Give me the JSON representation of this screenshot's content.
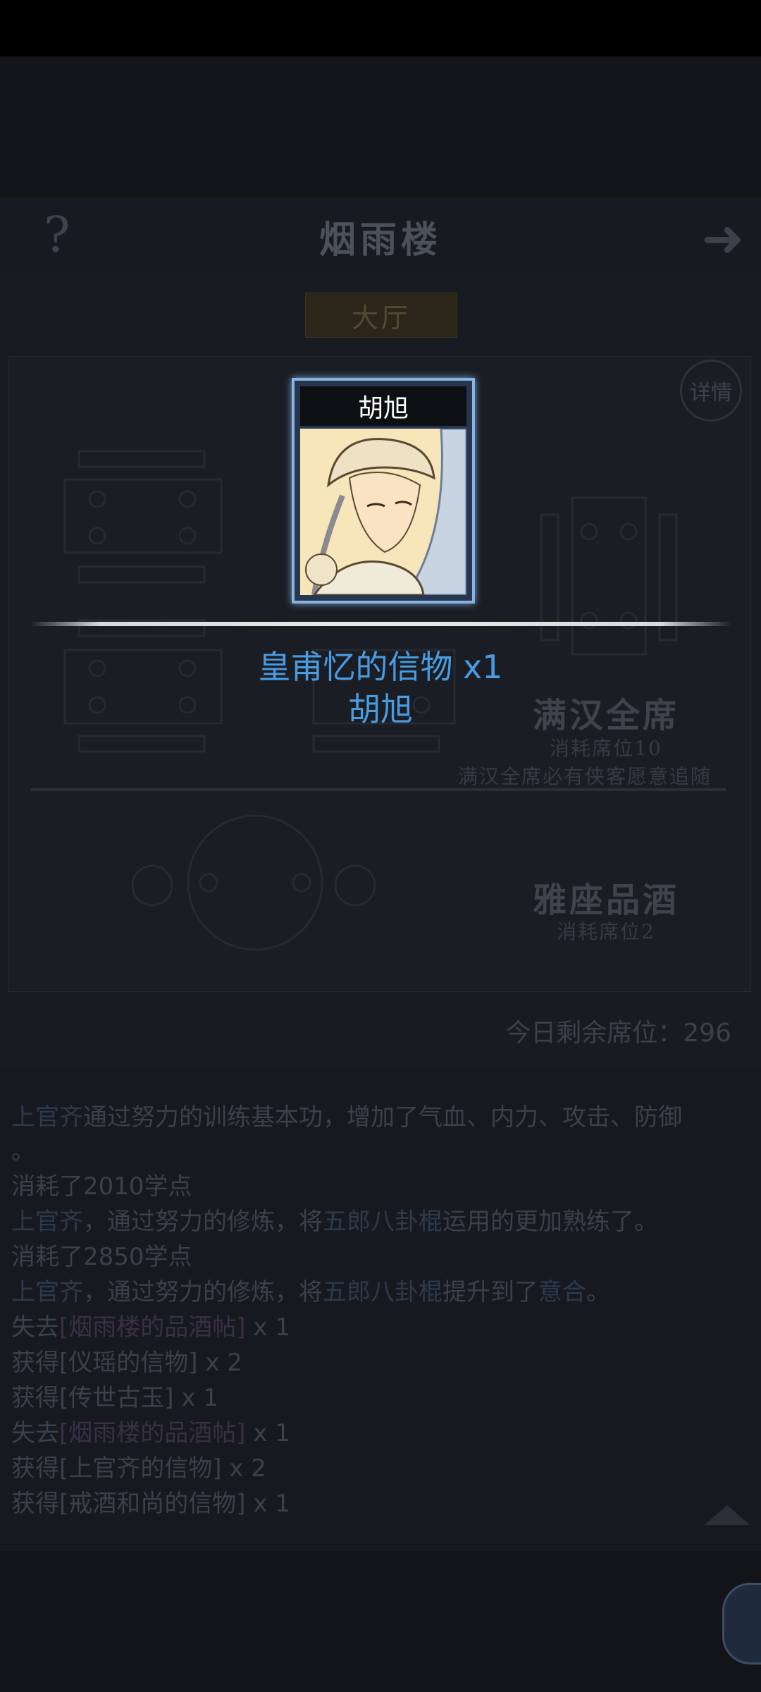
{
  "header": {
    "title": "烟雨楼",
    "help_icon": "question-mark-icon",
    "next_icon": "arrow-right-icon"
  },
  "tabs": {
    "hall": "大厅"
  },
  "details_button": "详情",
  "options": [
    {
      "title": "满汉全席",
      "cost": "消耗席位10",
      "note": "满汉全席必有侠客愿意追随"
    },
    {
      "title": "雅座品酒",
      "cost": "消耗席位2"
    }
  ],
  "seats_remaining": "今日剩余席位：296",
  "log": {
    "line1": {
      "name": "上官齐",
      "text": "通过努力的训练基本功，增加了气血、内力、攻击、防御"
    },
    "line2": "。",
    "line3": "消耗了2010学点",
    "line4": {
      "name": "上官齐",
      "pre": "，通过努力的修炼，将",
      "skill": "五郎八卦棍",
      "post": "运用的更加熟练了。"
    },
    "line5": "消耗了2850学点",
    "line6": {
      "name": "上官齐",
      "pre": "，通过努力的修炼，将",
      "skill": "五郎八卦棍",
      "mid": "提升到了",
      "level": "意合",
      "post": "。"
    },
    "line7": {
      "verb": "失去",
      "item": "[烟雨楼的品酒帖]",
      "qty": " x 1"
    },
    "line8": {
      "verb": "获得",
      "item": "[仪瑶的信物]",
      "qty": " x 2"
    },
    "line9": {
      "verb": "获得",
      "item": "[传世古玉]",
      "qty": " x 1"
    },
    "line10": {
      "verb": "失去",
      "item": "[烟雨楼的品酒帖]",
      "qty": " x 1"
    },
    "line11": {
      "verb": "获得",
      "item": "[上官齐的信物]",
      "qty": " x 2"
    },
    "line12": {
      "verb": "获得",
      "item": "[戒酒和尚的信物]",
      "qty": " x 1"
    }
  },
  "reward": {
    "card_name": "胡旭",
    "item_text": "皇甫忆的信物 x1",
    "character_name": "胡旭"
  },
  "colors": {
    "reward_text": "#4a9be0",
    "card_border": "#8ab3de",
    "background": "#121418"
  }
}
